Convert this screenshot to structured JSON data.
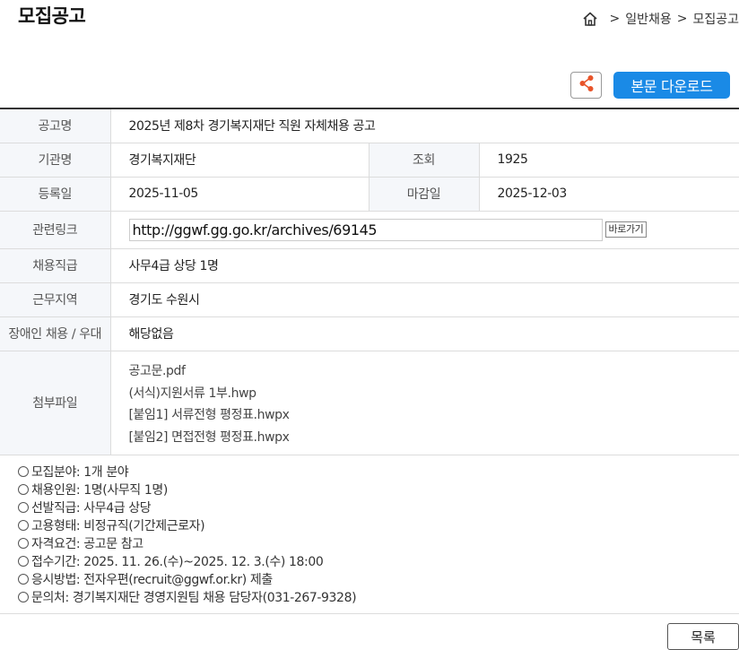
{
  "page": {
    "title": "모집공고"
  },
  "breadcrumb": {
    "separator": ">",
    "items": [
      "일반채용",
      "모집공고"
    ]
  },
  "toolbar": {
    "download_label": "본문 다운로드"
  },
  "info": {
    "title_label": "공고명",
    "title_value": "2025년 제8차 경기복지재단 직원 자체채용 공고",
    "org_label": "기관명",
    "org_value": "경기복지재단",
    "views_label": "조회",
    "views_value": "1925",
    "reg_label": "등록일",
    "reg_value": "2025-11-05",
    "deadline_label": "마감일",
    "deadline_value": "2025-12-03",
    "link_label": "관련링크",
    "link_value": "http://ggwf.gg.go.kr/archives/69145",
    "go_label": "바로가기",
    "position_label": "채용직급",
    "position_value": "사무4급 상당 1명",
    "region_label": "근무지역",
    "region_value": "경기도 수원시",
    "disability_label": "장애인 채용 / 우대",
    "disability_value": "해당없음",
    "files_label": "첨부파일",
    "files": [
      "공고문.pdf",
      "(서식)지원서류 1부.hwp",
      "[붙임1] 서류전형 평정표.hwpx",
      "[붙임2] 면접전형 평정표.hwpx"
    ]
  },
  "details": [
    "모집분야: 1개 분야",
    "채용인원: 1명(사무직 1명)",
    "선발직급: 사무4급 상당",
    "고용형태: 비정규직(기간제근로자)",
    "자격요건: 공고문 참고",
    "접수기간: 2025. 11.  26.(수)~2025. 12. 3.(수) 18:00",
    "응시방법: 전자우편(recruit@ggwf.or.kr) 제출",
    "문의처: 경기복지재단 경영지원팀 채용 담당자(031-267-9328)"
  ],
  "footer": {
    "list_label": "목록"
  },
  "colors": {
    "accent": "#1a8ae6",
    "header_bg": "#f5f7fa",
    "share_icon": "#e8542a"
  },
  "icons": {
    "home": "home-icon",
    "share": "share-icon",
    "bullet": "circle-bullet-icon"
  }
}
